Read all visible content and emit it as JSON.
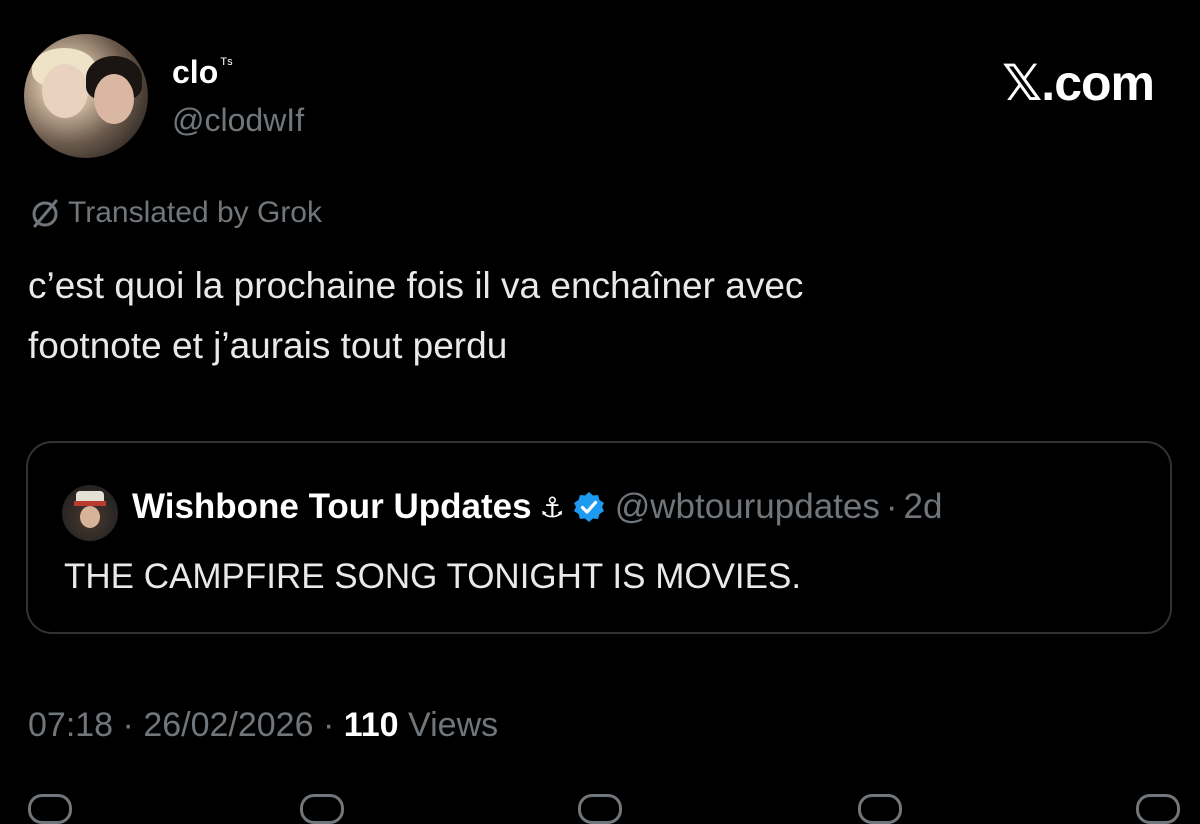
{
  "tweet": {
    "author": {
      "name": "clo",
      "name_suffix": "ᵀˢ",
      "handle": "@clodwIf"
    },
    "site_mark": "𝕏.com",
    "translation_note": "Translated by Grok",
    "text": "c’est quoi la prochaine fois il va enchaîner avec\nfootnote et j’aurais tout perdu",
    "quote": {
      "name": "Wishbone Tour Updates",
      "name_emoji": "⚓",
      "handle": "@wbtourupdates",
      "separator": "·",
      "time": "2d",
      "text": "THE CAMPFIRE SONG TONIGHT IS MOVIES."
    },
    "meta": {
      "time": "07:18",
      "separator1": "·",
      "date": "26/02/2026",
      "separator2": "·",
      "views_count": "110",
      "views_label": "Views"
    }
  },
  "icons": {
    "translate": "slashed-circle-icon",
    "verified": "verified-badge-icon",
    "verified_color": "#1d9bf0"
  },
  "colors": {
    "background": "#000000",
    "primary_text": "#e7e9ea",
    "secondary_text": "#71767b",
    "border": "#2f3336",
    "accent": "#1d9bf0"
  }
}
